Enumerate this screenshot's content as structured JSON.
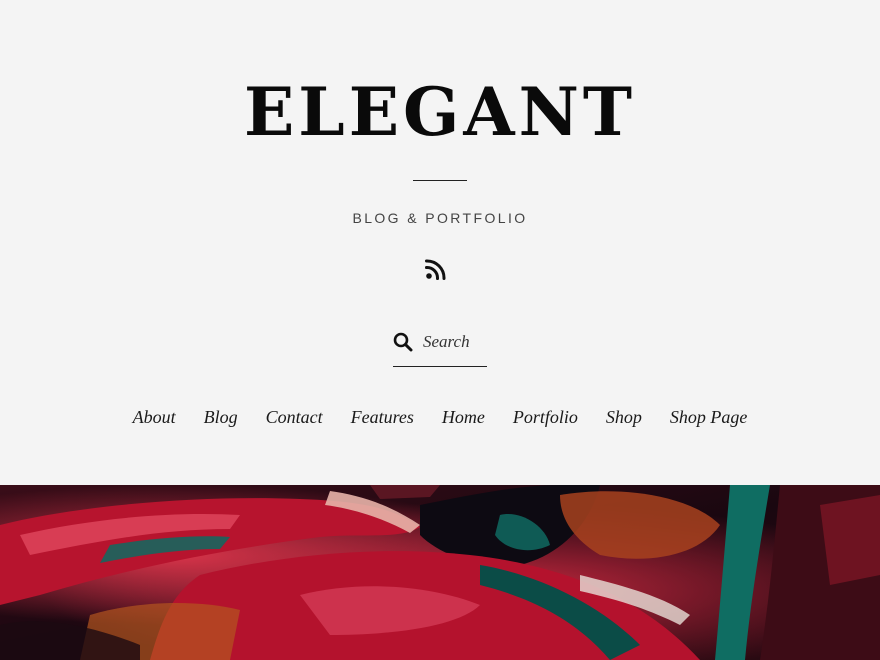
{
  "header": {
    "site_title": "ELEGANT",
    "tagline": "BLOG & PORTFOLIO",
    "rss_icon": "rss-icon"
  },
  "search": {
    "placeholder": "Search",
    "icon": "search-icon"
  },
  "nav": {
    "items": [
      {
        "label": "About"
      },
      {
        "label": "Blog"
      },
      {
        "label": "Contact"
      },
      {
        "label": "Features"
      },
      {
        "label": "Home"
      },
      {
        "label": "Portfolio"
      },
      {
        "label": "Shop"
      },
      {
        "label": "Shop Page"
      }
    ]
  },
  "colors": {
    "background": "#f4f4f4",
    "text": "#111111",
    "hero_red": "#b3122e",
    "hero_teal": "#0f5b55",
    "hero_dark": "#14060c"
  }
}
